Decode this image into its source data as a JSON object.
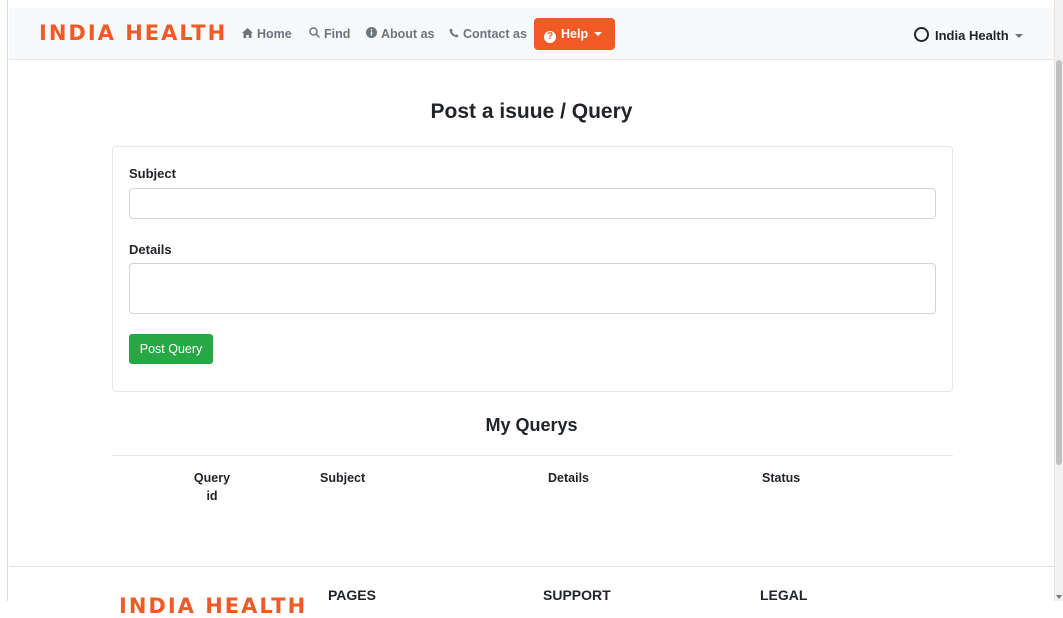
{
  "navbar": {
    "brand": "INDIA HEALTH",
    "links": [
      {
        "icon": "home-icon",
        "label": "Home"
      },
      {
        "icon": "search-icon",
        "label": "Find"
      },
      {
        "icon": "info-icon",
        "label": "About as"
      },
      {
        "icon": "phone-icon",
        "label": "Contact as"
      }
    ],
    "help_label": "Help",
    "user_label": "India Health"
  },
  "form": {
    "title": "Post a isuue / Query",
    "subject_label": "Subject",
    "subject_value": "",
    "details_label": "Details",
    "details_value": "",
    "submit_label": "Post Query"
  },
  "queries": {
    "title": "My Querys",
    "columns": [
      "Query id",
      "Subject",
      "Details",
      "Status"
    ],
    "rows": []
  },
  "footer": {
    "brand": "INDIA HEALTH",
    "columns": [
      "PAGES",
      "SUPPORT",
      "LEGAL"
    ]
  },
  "colors": {
    "brand": "#f15a24",
    "success": "#28a745"
  }
}
